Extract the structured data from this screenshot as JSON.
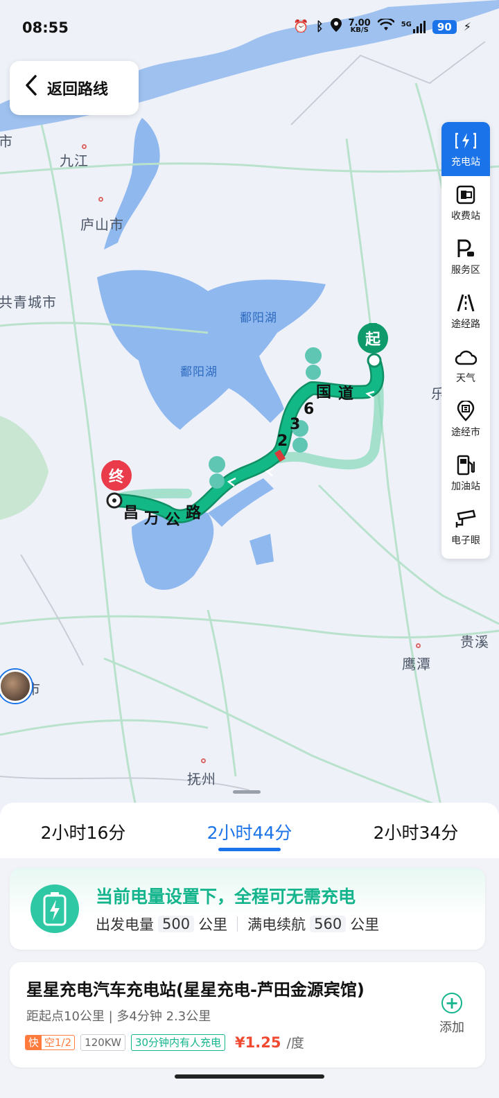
{
  "status_bar": {
    "time": "08:55",
    "net_speed_value": "7.00",
    "net_speed_unit": "KB/S",
    "network": "5G",
    "battery": "90"
  },
  "back_button": {
    "label": "返回路线"
  },
  "toolbar": {
    "items": [
      {
        "label": "充电站",
        "icon": "charging-icon",
        "active": true
      },
      {
        "label": "收费站",
        "icon": "toll-icon"
      },
      {
        "label": "服务区",
        "icon": "service-area-icon"
      },
      {
        "label": "途经路",
        "icon": "road-icon"
      },
      {
        "label": "天气",
        "icon": "weather-icon"
      },
      {
        "label": "途经市",
        "icon": "city-pin-icon"
      },
      {
        "label": "加油站",
        "icon": "fuel-icon"
      },
      {
        "label": "电子眼",
        "icon": "camera-icon"
      }
    ]
  },
  "map": {
    "labels": {
      "jiujiang": "九江",
      "lushan": "庐山市",
      "gongqing": "共青城市",
      "poyang_lake_1": "鄱阳湖",
      "poyang_lake_2": "鄱阳湖",
      "yingtan": "鹰潭",
      "guixi": "贵溪",
      "fuzhou": "抚州",
      "le": "乐",
      "shi_left_top": "市",
      "shi_left_bottom": "市"
    },
    "start_marker": "起",
    "end_marker": "终",
    "road_labels": {
      "g236_6": "6",
      "g236_3": "3",
      "g236_2": "2",
      "g236_guo": "国",
      "g236_dao": "道",
      "chang": "昌",
      "wan": "万",
      "gong": "公",
      "lu": "路"
    }
  },
  "route_tabs": [
    {
      "label": "2小时16分",
      "active": false
    },
    {
      "label": "2小时44分",
      "active": true
    },
    {
      "label": "2小时34分",
      "active": false
    }
  ],
  "charge_info": {
    "title": "当前电量设置下，全程可无需充电",
    "depart_label": "出发电量",
    "depart_value": "500",
    "depart_unit": "公里",
    "full_label": "满电续航",
    "full_value": "560",
    "full_unit": "公里"
  },
  "station": {
    "name": "星星充电汽车充电站(星星充电-芦田金源宾馆)",
    "info": "距起点10公里 | 多4分钟 2.3公里",
    "fast_label": "快",
    "availability": "空1/2",
    "power": "120KW",
    "busy": "30分钟内有人充电",
    "price": "¥1.25",
    "price_unit": "/度",
    "add_label": "添加"
  },
  "colors": {
    "accent": "#1a73e8",
    "route_green": "#12b886",
    "lake_blue": "#8fb8ef",
    "charge_green": "#14b48c",
    "price_red": "#f04a32"
  }
}
